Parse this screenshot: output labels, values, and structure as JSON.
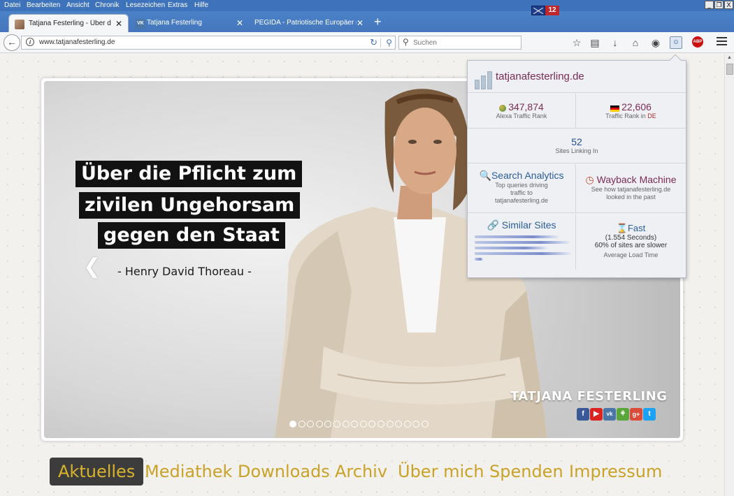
{
  "menu": [
    "Datei",
    "Bearbeiten",
    "Ansicht",
    "Chronik",
    "Lesezeichen",
    "Extras",
    "Hilfe"
  ],
  "window_controls": {
    "minimize": "_",
    "restore": "❐",
    "close": "X"
  },
  "tabs": [
    {
      "title": "Tatjana Festerling - Über die ...",
      "close": "✕"
    },
    {
      "title": "Tatjana Festerling",
      "close": "✕"
    },
    {
      "title": "PEGIDA - Patriotische Europäer ge...",
      "close": "✕"
    }
  ],
  "new_tab": "+",
  "address_bar": {
    "url": "www.tatjanafesterling.de"
  },
  "search_bar": {
    "placeholder": "Suchen"
  },
  "toolbar": {
    "mail_count": "12",
    "abp_label": "ABP"
  },
  "hero": {
    "quote_lines": [
      "Über die Pflicht zum",
      "zivilen Ungehorsam",
      "gegen den Staat"
    ],
    "author": "- Henry David Thoreau -",
    "brand": "TATJANA FESTERLING",
    "social": [
      "f",
      "▶",
      "vk",
      "⚘",
      "g+",
      "t"
    ],
    "slides_total": 16,
    "active_slide_index": 0
  },
  "main_nav": [
    "Aktuelles",
    "Mediathek",
    "Downloads",
    "Archiv",
    "Über mich",
    "Spenden",
    "Impressum"
  ],
  "alexa": {
    "site": "tatjanafesterling.de",
    "global_rank": "347,874",
    "global_rank_label": "Alexa Traffic Rank",
    "country_rank": "22,606",
    "country_rank_label": "Traffic Rank in",
    "country_code": "DE",
    "links_in": "52",
    "links_in_label": "Sites Linking In",
    "search_title": "Search Analytics",
    "search_desc_1": "Top queries driving",
    "search_desc_2": "traffic to",
    "search_desc_3": "tatjanafesterling.de",
    "wayback_title": "Wayback Machine",
    "wayback_desc_1": "See how tatjanafesterling.de",
    "wayback_desc_2": "looked in the past",
    "similar_title": "Similar Sites",
    "speed_title": "Fast",
    "speed_seconds": "(1.554 Seconds)",
    "speed_slower": "60% of sites are slower",
    "speed_label": "Average Load Time"
  },
  "colors": {
    "nav_gold": "#c9a227",
    "alexa_link": "#7b2b56",
    "tabstrip": "#4576bd"
  }
}
